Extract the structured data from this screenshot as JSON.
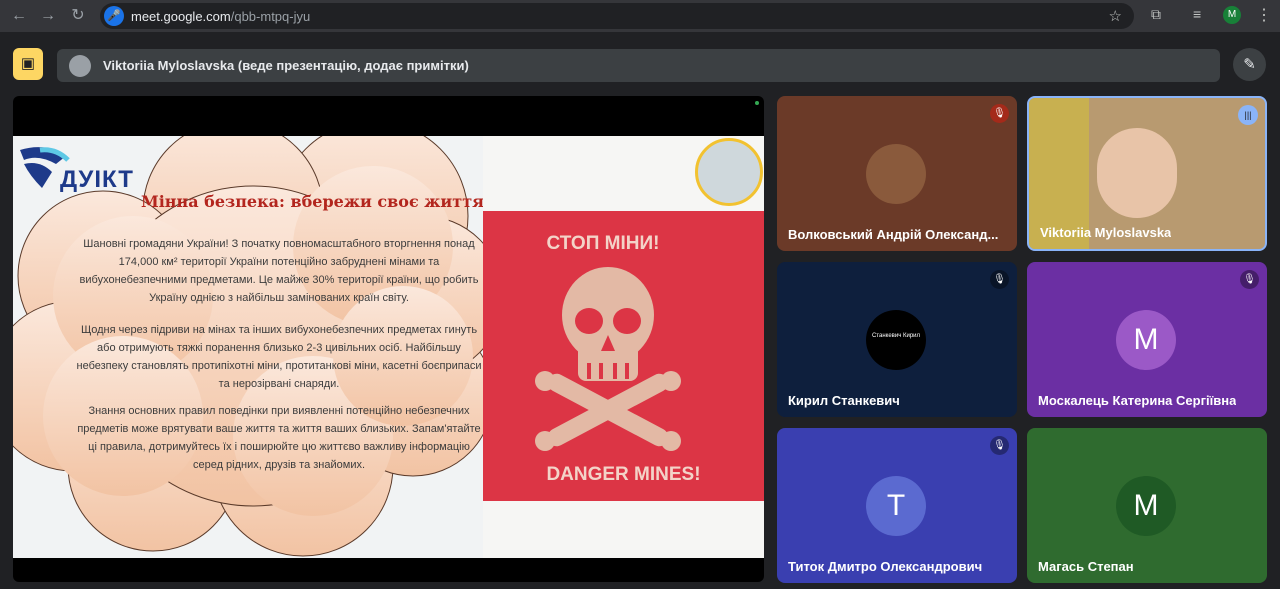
{
  "browser": {
    "url_host": "meet.google.com",
    "url_path": "/qbb-mtpq-jyu",
    "profile_initial": "M",
    "icons": [
      "back-icon",
      "forward-icon",
      "reload-icon",
      "star-icon",
      "extensions-icon",
      "media-icon",
      "profile-icon",
      "menu-icon"
    ]
  },
  "meeting": {
    "presenter_banner": "Viktoriia Myloslavska (веде презентацію, додає примітки)"
  },
  "slide": {
    "logo_text": "ДУІКТ",
    "title": "Мінна безпека: вбережи своє життя",
    "paragraph_1": "Шановні громадяни України! З початку повномасштабного вторгнення понад 174,000 км² території України потенційно забруднені мінами та вибухонебезпечними предметами. Це майже 30% території країни, що робить Україну однією з найбільш замінованих країн світу.",
    "paragraph_2": "Щодня через підриви на мінах та інших вибухонебезпечних предметах гинуть або отримують тяжкі поранення близько 2-3 цивільних осіб. Найбільшу небезпеку становлять протипіхотні міни, протитанкові міни, касетні боєприпаси та нерозірвані снаряди.",
    "paragraph_3": "Знання основних правил поведінки при виявленні потенційно небезпечних предметів може врятувати ваше життя та життя ваших близьких. Запам'ятайте ці правила, дотримуйтесь їх і поширюйте цю життєво важливу інформацію серед рідних, друзів та знайомих.",
    "sign_top": "СТОП МІНИ!",
    "sign_bottom": "DANGER MINES!"
  },
  "participants": [
    {
      "name": "Волковський Андрій Олександ...",
      "muted": true,
      "bg": "#6b3a28"
    },
    {
      "name": "Viktoriia Myloslavska",
      "speaking": true,
      "bg": "#b89a70"
    },
    {
      "name": "Кирил Станкевич",
      "muted": true,
      "avatar_text": "Станкевич Кирил",
      "bg": "#0e1f3d"
    },
    {
      "name": "Москалець Катерина Сергіївна",
      "muted": true,
      "initial": "M",
      "bg": "#6b2fa3"
    },
    {
      "name": "Титок Дмитро Олександрович",
      "muted": true,
      "initial": "T",
      "bg": "#3a3fb0"
    },
    {
      "name": "Магась Степан",
      "initial": "M",
      "bg": "#2f6b2f"
    }
  ]
}
